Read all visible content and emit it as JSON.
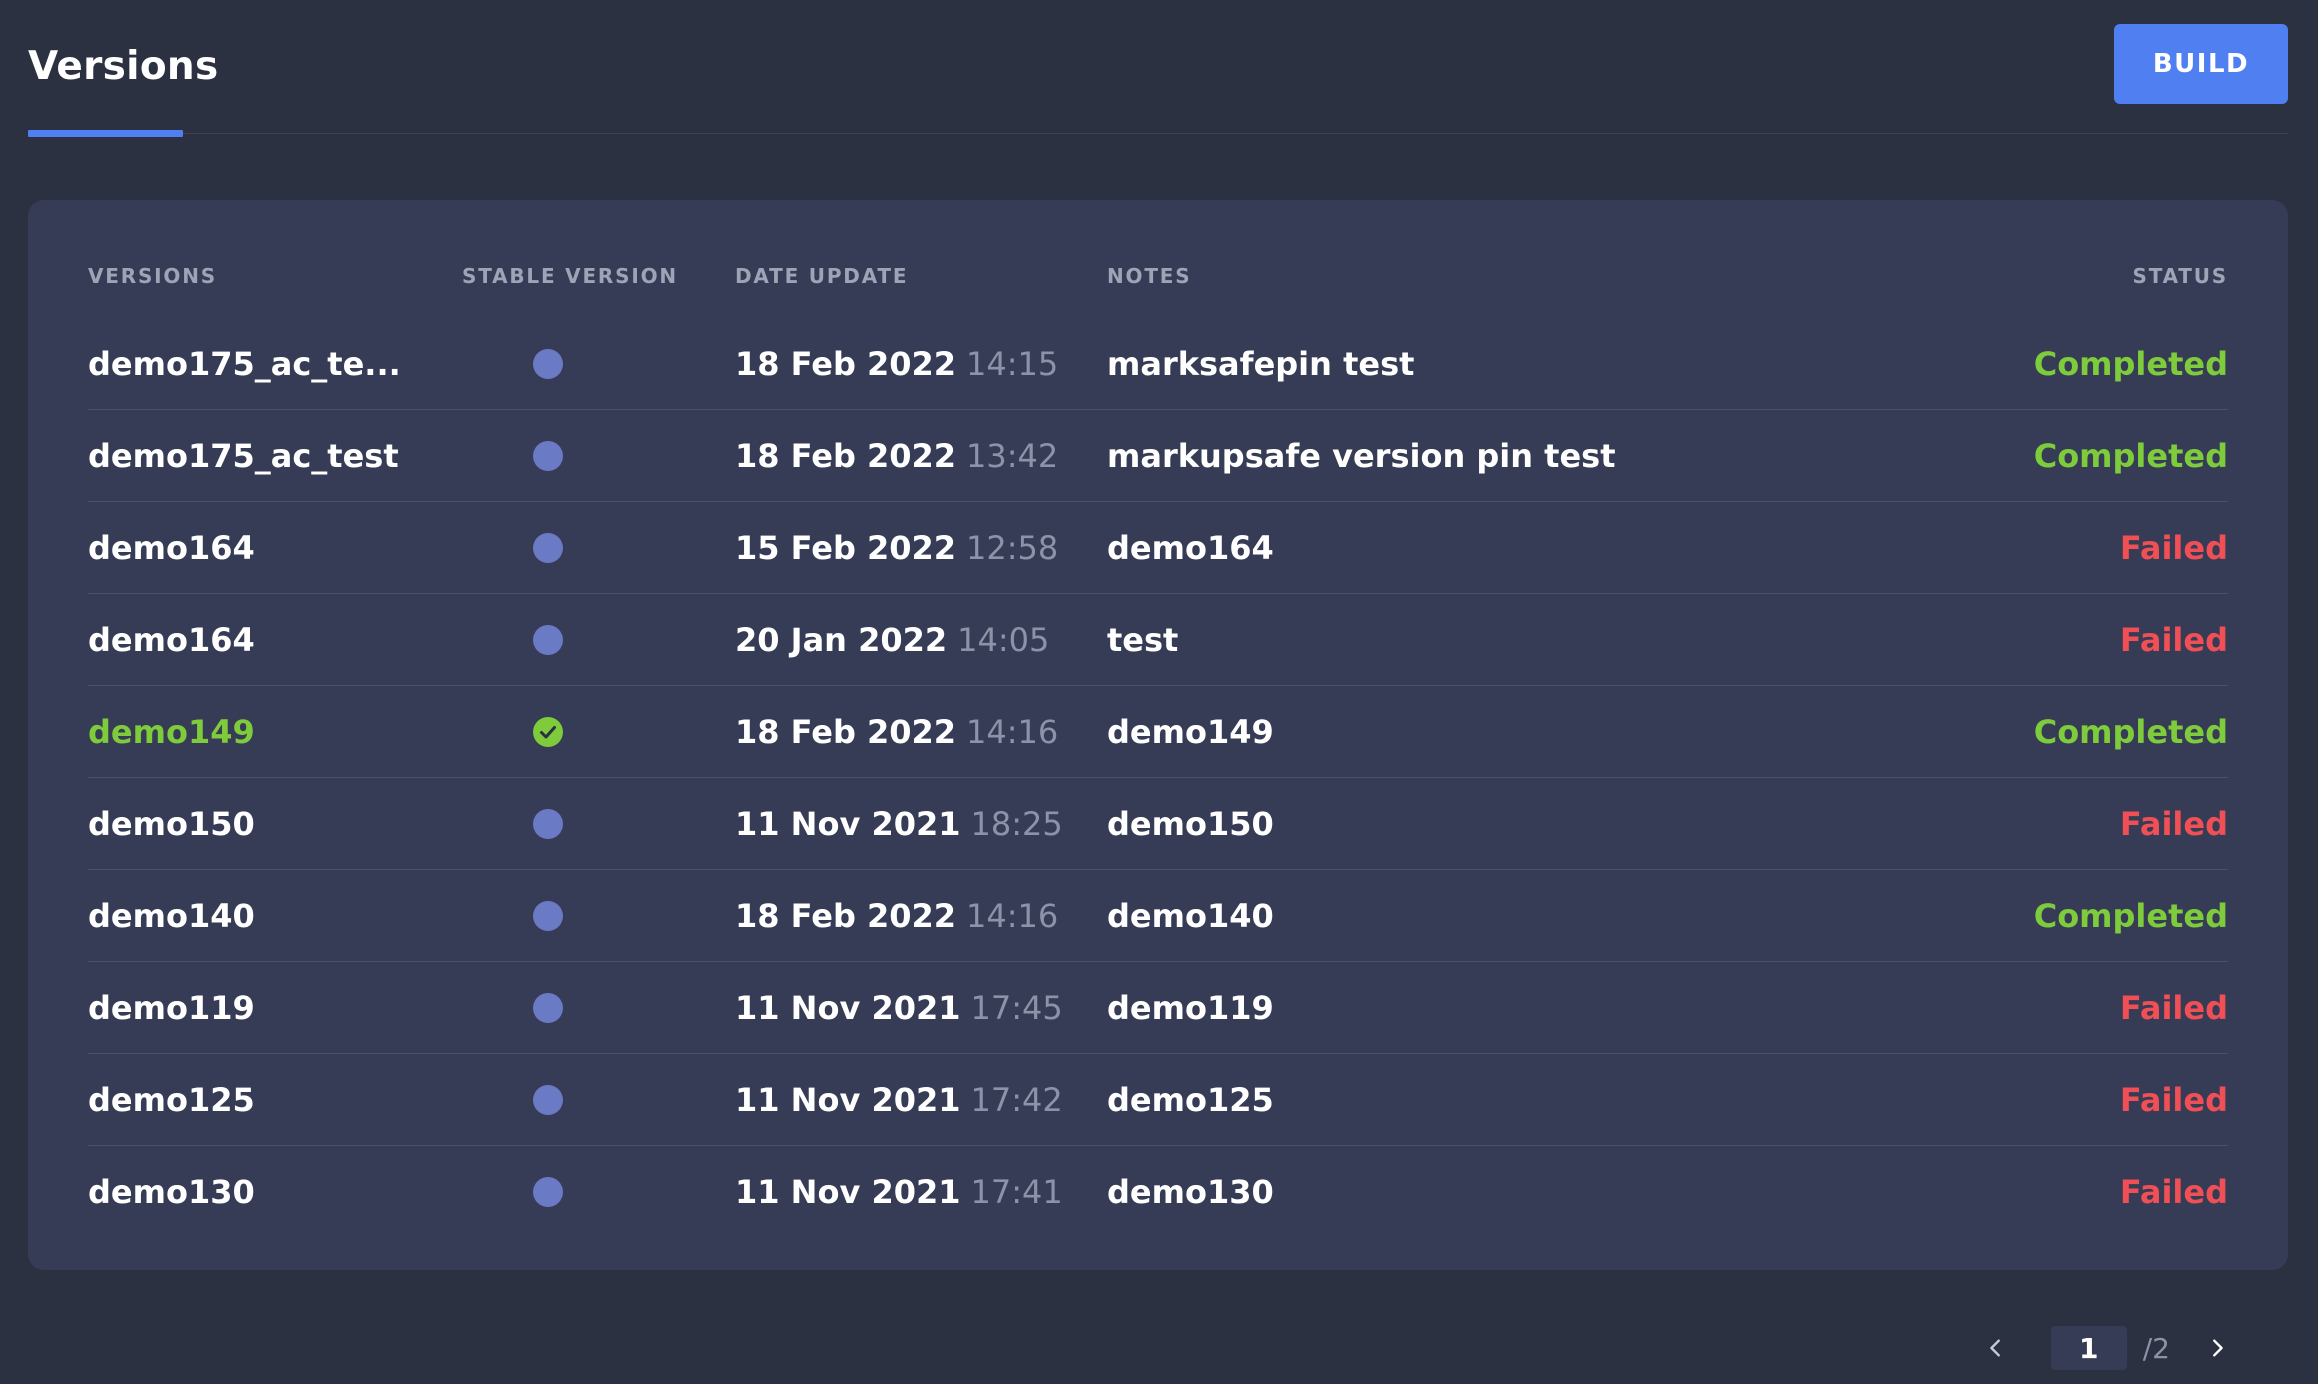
{
  "header": {
    "title": "Versions",
    "build_label": "BUILD"
  },
  "colors": {
    "accent": "#4f7ff0",
    "completed": "#7ecb3b",
    "failed": "#ef4f55",
    "stable_dot": "#6b7ac4"
  },
  "table": {
    "columns": {
      "version": "VERSIONS",
      "stable": "STABLE VERSION",
      "date": "DATE UPDATE",
      "notes": "NOTES",
      "status": "STATUS"
    },
    "rows": [
      {
        "version": "demo175_ac_te...",
        "stable": false,
        "date": "18 Feb 2022",
        "time": "14:15",
        "notes": "marksafepin test",
        "status": "Completed"
      },
      {
        "version": "demo175_ac_test",
        "stable": false,
        "date": "18 Feb 2022",
        "time": "13:42",
        "notes": "markupsafe version pin test",
        "status": "Completed"
      },
      {
        "version": "demo164",
        "stable": false,
        "date": "15 Feb 2022",
        "time": "12:58",
        "notes": "demo164",
        "status": "Failed"
      },
      {
        "version": "demo164",
        "stable": false,
        "date": "20 Jan 2022",
        "time": "14:05",
        "notes": "test",
        "status": "Failed"
      },
      {
        "version": "demo149",
        "stable": true,
        "date": "18 Feb 2022",
        "time": "14:16",
        "notes": "demo149",
        "status": "Completed"
      },
      {
        "version": "demo150",
        "stable": false,
        "date": "11 Nov 2021",
        "time": "18:25",
        "notes": "demo150",
        "status": "Failed"
      },
      {
        "version": "demo140",
        "stable": false,
        "date": "18 Feb 2022",
        "time": "14:16",
        "notes": "demo140",
        "status": "Completed"
      },
      {
        "version": "demo119",
        "stable": false,
        "date": "11 Nov 2021",
        "time": "17:45",
        "notes": "demo119",
        "status": "Failed"
      },
      {
        "version": "demo125",
        "stable": false,
        "date": "11 Nov 2021",
        "time": "17:42",
        "notes": "demo125",
        "status": "Failed"
      },
      {
        "version": "demo130",
        "stable": false,
        "date": "11 Nov 2021",
        "time": "17:41",
        "notes": "demo130",
        "status": "Failed"
      }
    ]
  },
  "pagination": {
    "current": "1",
    "total": "/2"
  }
}
